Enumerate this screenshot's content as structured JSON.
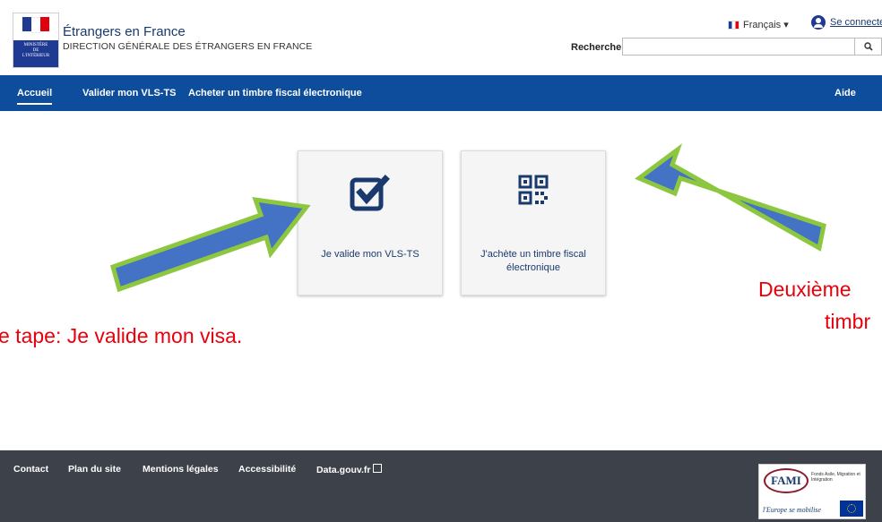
{
  "header": {
    "logo_lines": [
      "MINISTÈRE",
      "DE",
      "L'INTÉRIEUR"
    ],
    "title": "Étrangers en France",
    "subtitle": "DIRECTION GÉNÉRALE DES ÉTRANGERS EN FRANCE",
    "language": "Français ▾",
    "connect_label": "Se connecter",
    "search_label": "Rechercher",
    "search_placeholder": "",
    "search_button_icon": "search-icon"
  },
  "nav": {
    "items": [
      {
        "label": "Accueil",
        "active": true
      },
      {
        "label": "Valider mon VLS-TS",
        "active": false
      },
      {
        "label": "Acheter un timbre fiscal électronique",
        "active": false
      }
    ],
    "help": "Aide"
  },
  "cards": [
    {
      "label": "Je valide mon VLS-TS",
      "icon": "checkbox-checked-icon"
    },
    {
      "label": "J'achète un timbre fiscal électronique",
      "icon": "qr-code-icon"
    }
  ],
  "annotations": {
    "left": "e tape: Je valide mon visa.",
    "right_line1": "Deuxième",
    "right_line2": "timbr",
    "color": "#e8000d",
    "arrow_color": "#4472c4",
    "arrow_border_color": "#8dc63f"
  },
  "footer": {
    "links": [
      "Contact",
      "Plan du site",
      "Mentions légales",
      "Accessibilité",
      "Data.gouv.fr"
    ],
    "fami_logo": "FAMI",
    "fami_subtitle": "Fonds Asile, Migration et Intégration",
    "fami_motto": "l'Europe se mobilise"
  },
  "colors": {
    "nav_bg": "#0d4d9c",
    "footer_bg": "#3c414a",
    "link_blue": "#1a3a6e"
  }
}
